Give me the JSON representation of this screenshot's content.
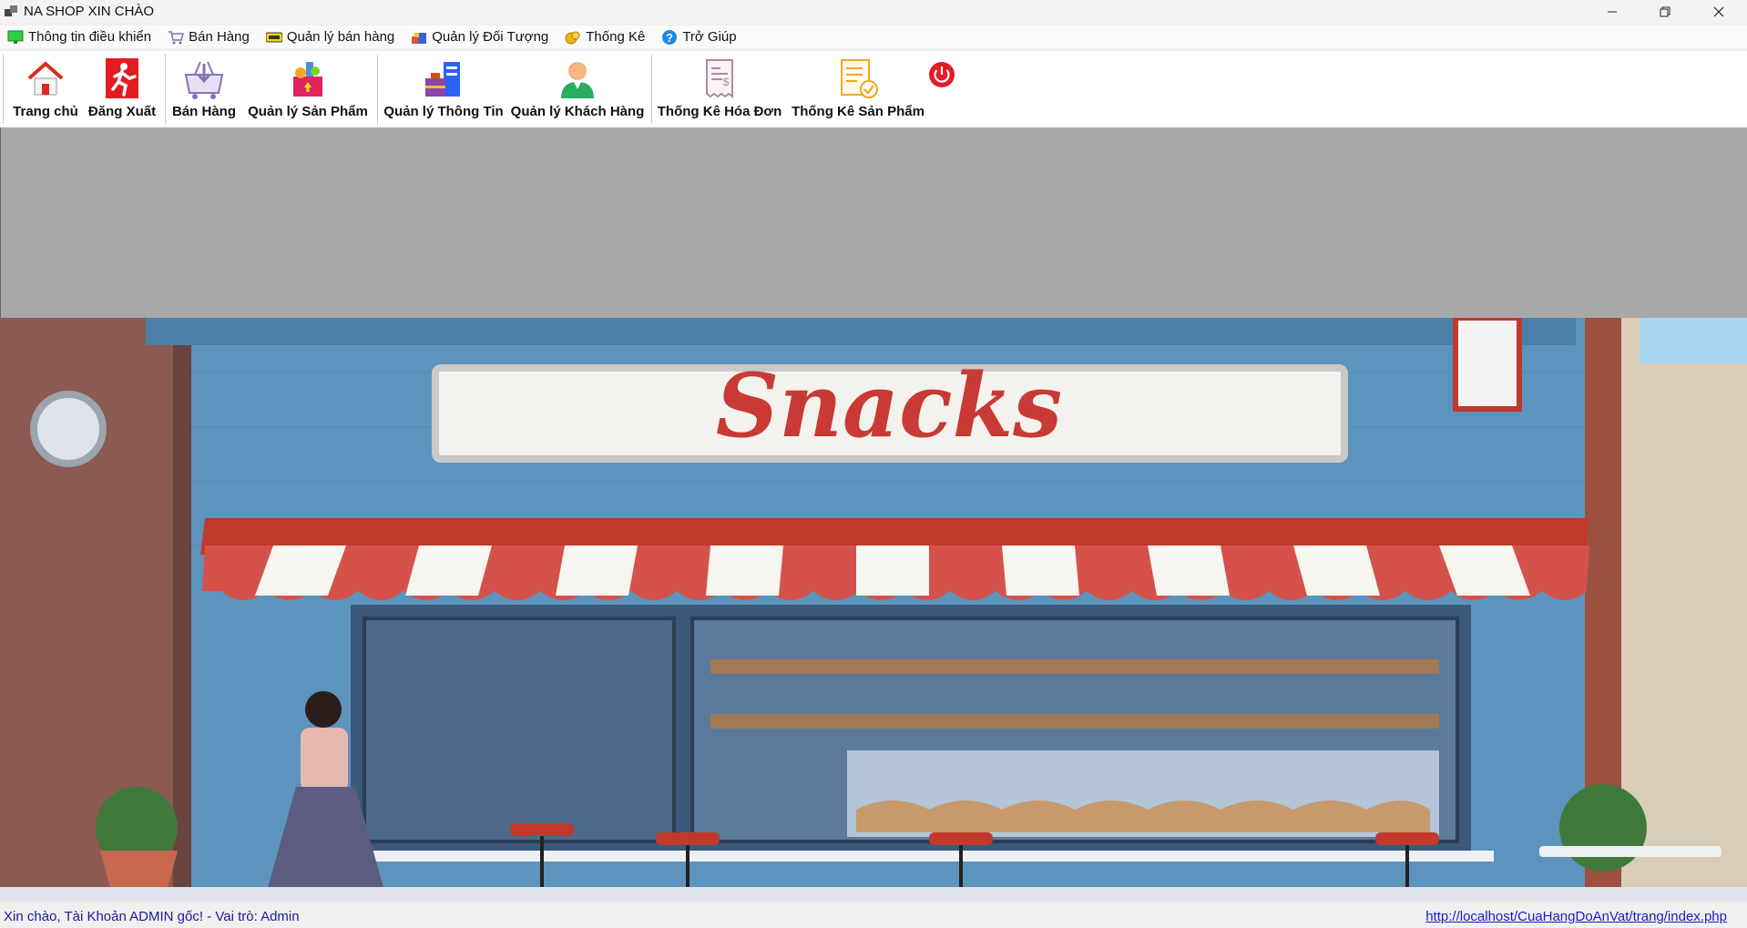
{
  "window": {
    "title": "NA SHOP XIN CHÀO",
    "controls": {
      "minimize": "minimize",
      "restore": "restore",
      "close": "close"
    }
  },
  "menu": [
    {
      "label": "Thông tin điều khiển",
      "icon": "monitor-icon"
    },
    {
      "label": "Bán Hàng",
      "icon": "cart-icon"
    },
    {
      "label": "Quản lý bán hàng",
      "icon": "new-badge-icon"
    },
    {
      "label": "Quản lý Đối Tượng",
      "icon": "objects-icon"
    },
    {
      "label": "Thống Kê",
      "icon": "coins-icon"
    },
    {
      "label": "Trở Giúp",
      "icon": "help-icon"
    }
  ],
  "toolbar": [
    {
      "label": "Trang chủ",
      "icon": "home-icon"
    },
    {
      "label": "Đăng Xuất",
      "icon": "exit-icon"
    },
    {
      "label": "Bán Hàng",
      "icon": "basket-icon"
    },
    {
      "label": "Quản lý Sản Phẩm",
      "icon": "grocery-bag-icon"
    },
    {
      "label": "Quản lý Thông Tin",
      "icon": "info-management-icon"
    },
    {
      "label": "Quản lý Khách Hàng",
      "icon": "customer-icon"
    },
    {
      "label": "Thống Kê Hóa Đơn",
      "icon": "receipt-icon"
    },
    {
      "label": "Thống Kê Sản Phẩm",
      "icon": "product-report-icon"
    },
    {
      "label": "",
      "icon": "power-icon"
    }
  ],
  "banner": {
    "sign_text": "Snacks"
  },
  "status": {
    "greeting": "Xin chào, Tài Khoản ADMIN gốc! - Vai trò: Admin",
    "link": "http://localhost/CuaHangDoAnVat/trang/index.php"
  },
  "colors": {
    "accent_red": "#e31b23",
    "status_text": "#1a1a9e",
    "link": "#1a1acc",
    "content_gray": "#a8a8a8"
  }
}
